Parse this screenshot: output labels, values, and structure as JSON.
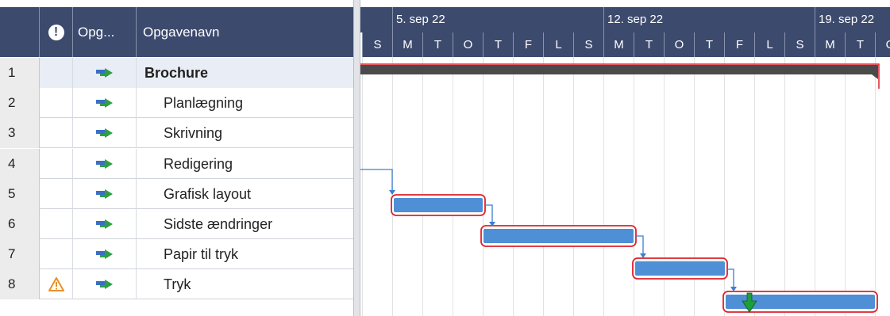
{
  "grid": {
    "headers": {
      "indicators_icon": "!",
      "mode": "Opg...",
      "name": "Opgavenavn"
    },
    "rows": [
      {
        "num": "1",
        "name": "Brochure",
        "summary": true,
        "warning": false
      },
      {
        "num": "2",
        "name": "Planlægning",
        "summary": false,
        "warning": false
      },
      {
        "num": "3",
        "name": "Skrivning",
        "summary": false,
        "warning": false
      },
      {
        "num": "4",
        "name": "Redigering",
        "summary": false,
        "warning": false
      },
      {
        "num": "5",
        "name": "Grafisk layout",
        "summary": false,
        "warning": false
      },
      {
        "num": "6",
        "name": "Sidste ændringer",
        "summary": false,
        "warning": false
      },
      {
        "num": "7",
        "name": "Papir til tryk",
        "summary": false,
        "warning": false
      },
      {
        "num": "8",
        "name": "Tryk",
        "summary": false,
        "warning": true
      }
    ]
  },
  "timeline": {
    "weeks": [
      "5. sep 22",
      "12. sep 22",
      "19. sep 22"
    ],
    "days": [
      "S",
      "M",
      "T",
      "O",
      "T",
      "F",
      "L",
      "S",
      "M",
      "T",
      "O",
      "T",
      "F",
      "L",
      "S",
      "M",
      "T",
      "O"
    ]
  },
  "colors": {
    "header_bg": "#3c4a6e",
    "task_bar": "#4f8fd6",
    "critical_outline": "#e0202a",
    "summary_bar": "#4a4a4a",
    "link": "#3a7fd1",
    "deadline": "#1e9e3a"
  },
  "icons": {
    "task_mode": "auto-scheduled-task-icon",
    "warning": "warning-triangle-icon",
    "deadline": "deadline-arrow-icon"
  }
}
